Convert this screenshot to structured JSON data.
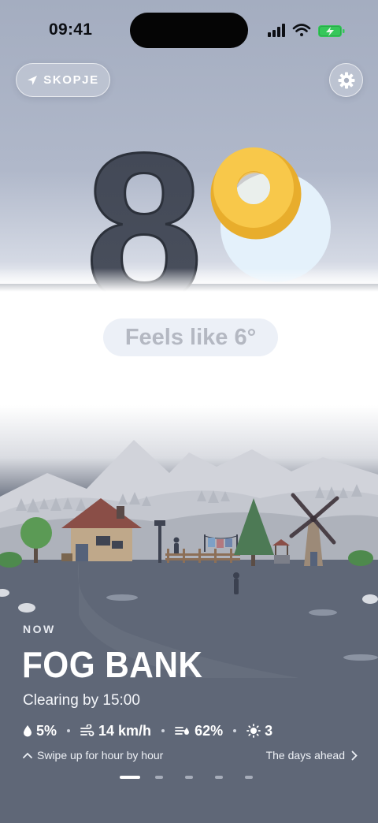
{
  "status_bar": {
    "time": "09:41"
  },
  "location": {
    "label": "SKOPJE"
  },
  "temperature": {
    "value": "8"
  },
  "feels_like": {
    "text": "Feels like 6°"
  },
  "current": {
    "section_label": "NOW",
    "condition": "FOG BANK",
    "subtitle": "Clearing by 15:00"
  },
  "metrics": [
    {
      "icon": "raindrop-icon",
      "value": "5%"
    },
    {
      "icon": "wind-icon",
      "value": "14 km/h"
    },
    {
      "icon": "humidity-icon",
      "value": "62%"
    },
    {
      "icon": "uv-sun-icon",
      "value": "3"
    }
  ],
  "navigation": {
    "swipe_hint": "Swipe up for hour by hour",
    "days_link": "The days ahead"
  },
  "pager": {
    "count": 5,
    "active_index": 0
  },
  "colors": {
    "sky": "#a4adc0",
    "ground": "#5f6777",
    "sun": "#f8c84a",
    "numeral": "#454b57"
  }
}
